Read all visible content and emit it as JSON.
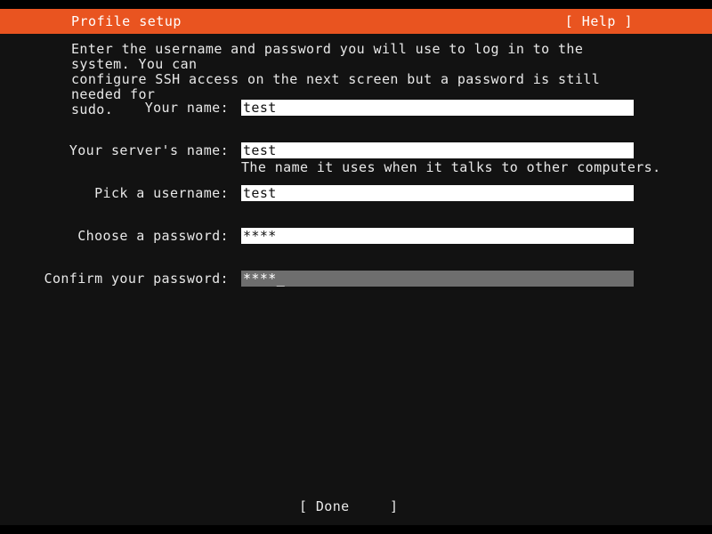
{
  "header": {
    "title": "Profile setup",
    "help_label": "[ Help ]"
  },
  "body": {
    "description": "Enter the username and password you will use to log in to the system. You can\nconfigure SSH access on the next screen but a password is still needed for\nsudo."
  },
  "form": {
    "fields": [
      {
        "label": "Your name:",
        "value": "test",
        "help": "",
        "focused": false
      },
      {
        "label": "Your server's name:",
        "value": "test",
        "help": "The name it uses when it talks to other computers.",
        "focused": false
      },
      {
        "label": "Pick a username:",
        "value": "test",
        "help": "",
        "focused": false
      },
      {
        "label": "Choose a password:",
        "value": "****",
        "help": "",
        "focused": false
      },
      {
        "label": "Confirm your password:",
        "value": "****",
        "help": "",
        "focused": true,
        "cursor": "_"
      }
    ]
  },
  "footer": {
    "done_label": "[ Done",
    "done_bracket": "]"
  },
  "colors": {
    "accent_orange": "#e95420",
    "background": "#121212",
    "strip_black": "#000000",
    "field_background": "#ffffff",
    "field_focused_background": "#6e6e6e",
    "text": "#e8e8e8"
  }
}
